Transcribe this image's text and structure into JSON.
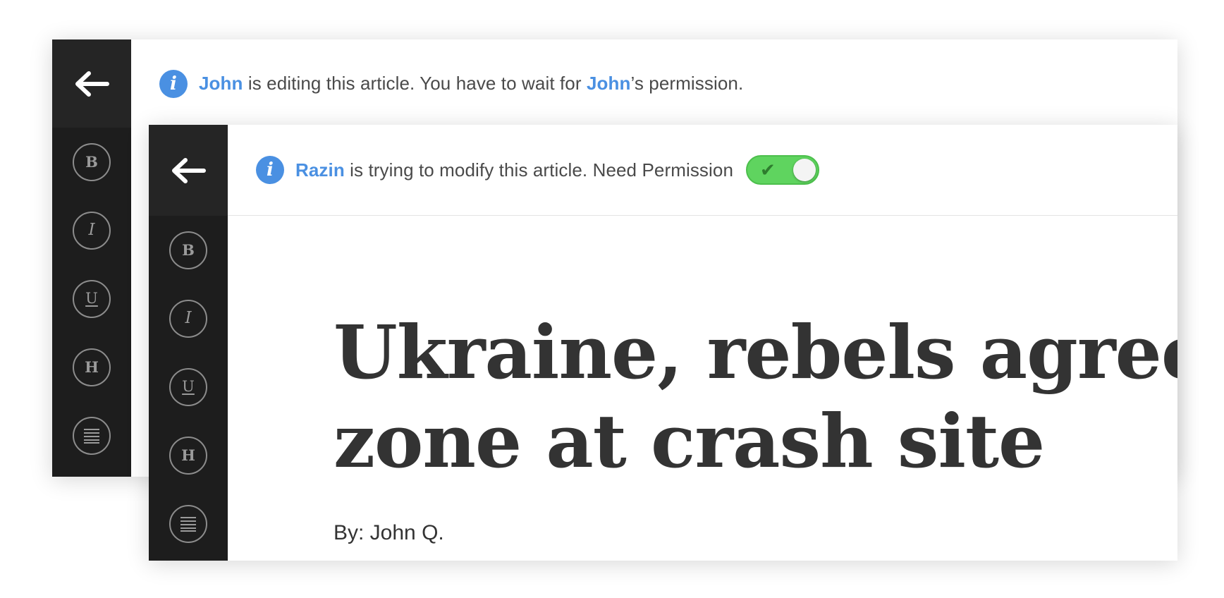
{
  "back_panel": {
    "notice": {
      "name": "John",
      "text1": " is editing this article. You have to wait for ",
      "name2": "John",
      "text2": "’s permission."
    },
    "tools": [
      "B",
      "I",
      "U",
      "H"
    ]
  },
  "front_panel": {
    "notice": {
      "name": "Razin",
      "text": " is trying to modify this article. Need Permission",
      "toggle_state": "on"
    },
    "tools": [
      "B",
      "I",
      "U",
      "H"
    ],
    "article": {
      "title_line1": "Ukraine, rebels agree",
      "title_line2": "zone at crash site",
      "byline": "By: John Q."
    }
  },
  "icons": {
    "back": "arrow-left-icon",
    "info": "info-icon",
    "justify": "align-justify-icon",
    "check": "check-icon"
  },
  "colors": {
    "accent": "#4a90e2",
    "sidebar": "#1d1d1d",
    "toggle": "#5fd45f",
    "text": "#333333"
  }
}
